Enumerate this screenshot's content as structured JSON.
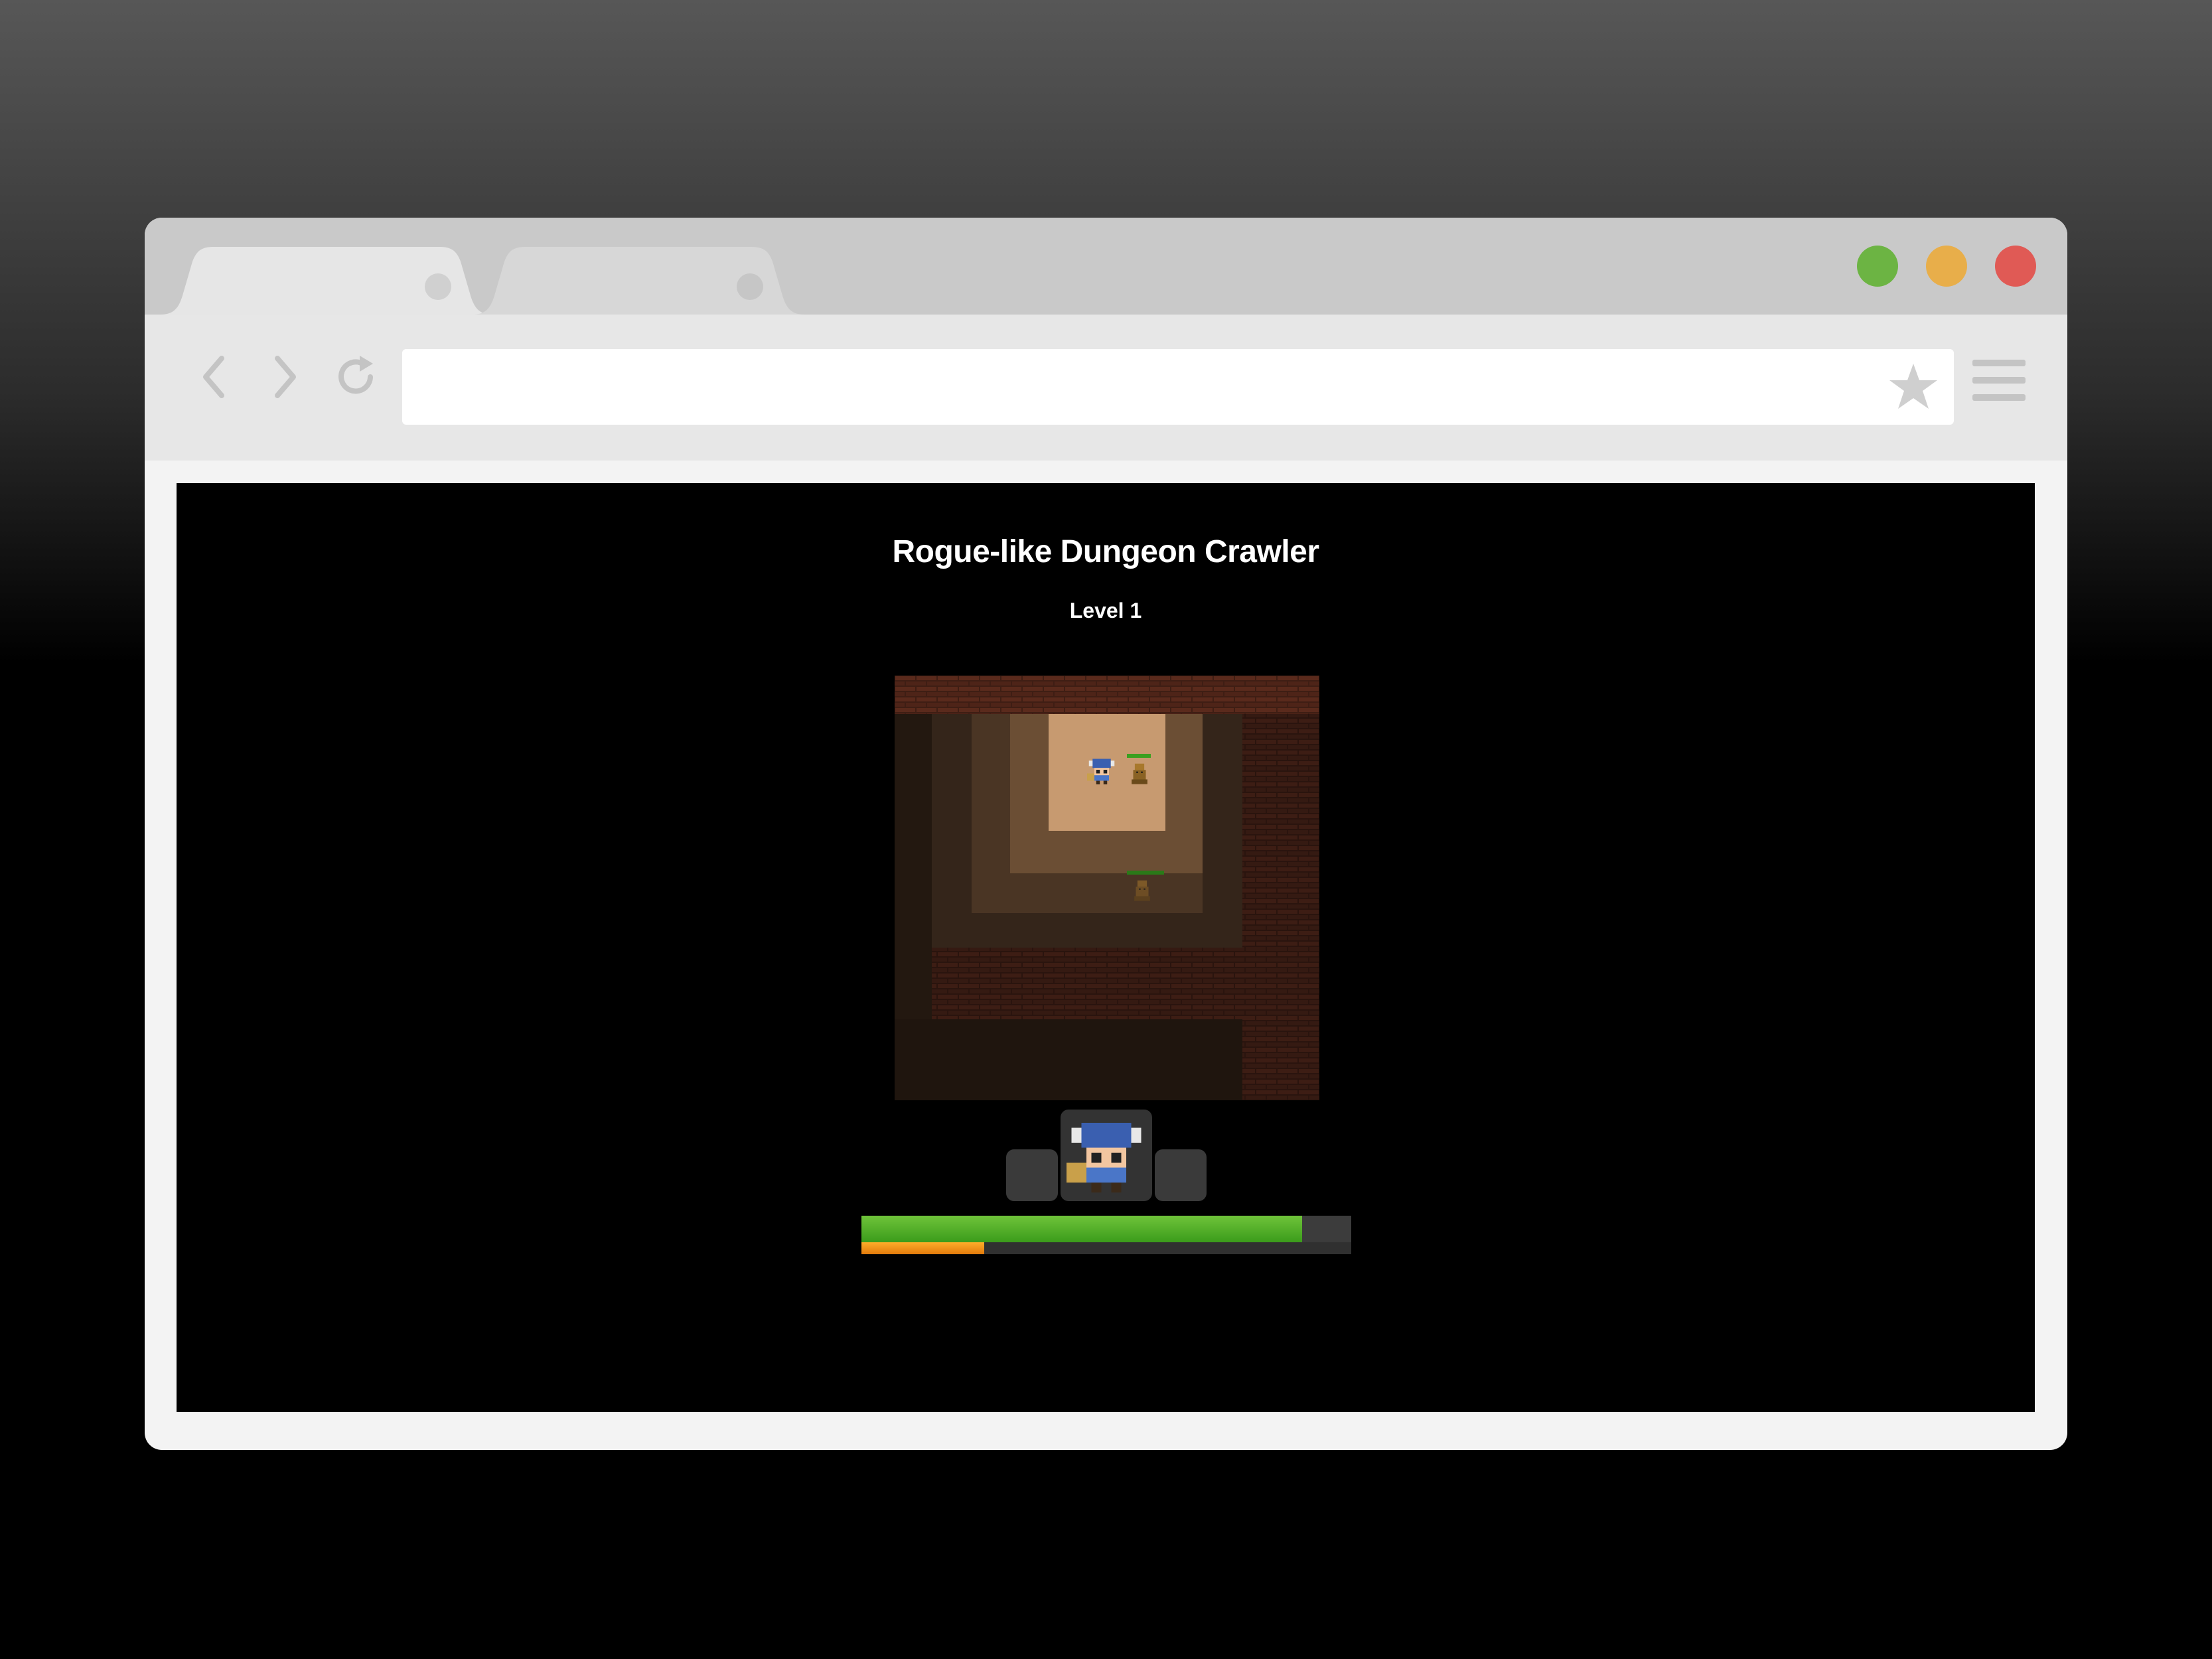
{
  "window": {
    "controls": [
      "green-dot",
      "yellow-dot",
      "red-dot"
    ],
    "colors": {
      "green": "#6cb443",
      "yellow": "#e8ae4a",
      "red": "#e05a55"
    }
  },
  "tabs": [
    {
      "label": ""
    },
    {
      "label": ""
    }
  ],
  "toolbar": {
    "back_icon": "chevron-left-icon",
    "forward_icon": "chevron-right-icon",
    "reload_icon": "reload-icon",
    "address_value": "",
    "bookmark_icon": "star-icon",
    "menu_icon": "hamburger-menu-icon"
  },
  "game": {
    "title": "Rogue-like Dungeon Crawler",
    "level_label": "Level 1",
    "player_sprite": "viking-hero-icon",
    "enemy_sprite": "goblin-enemy-icon",
    "health_fraction": 0.9,
    "experience_fraction": 0.25,
    "colors": {
      "health": "#4caf28",
      "experience": "#f39c1a"
    }
  }
}
